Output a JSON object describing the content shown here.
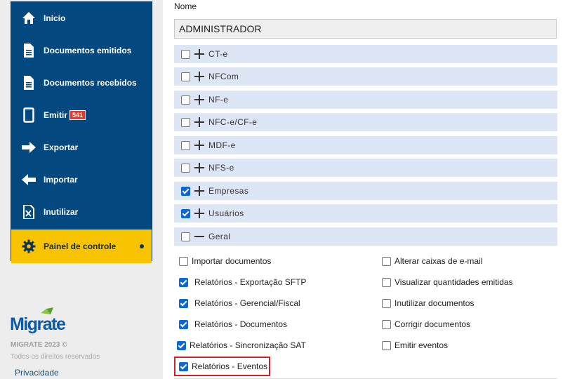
{
  "sidebar": {
    "items": [
      {
        "label": "Início",
        "icon": "home-icon"
      },
      {
        "label": "Documentos emitidos",
        "icon": "document-icon"
      },
      {
        "label": "Documentos recebidos",
        "icon": "document-icon"
      },
      {
        "label": "Emitir",
        "icon": "tablet-icon",
        "badge": "541"
      },
      {
        "label": "Exportar",
        "icon": "arrow-right-icon"
      },
      {
        "label": "Importar",
        "icon": "arrow-left-icon"
      },
      {
        "label": "Inutilizar",
        "icon": "cancel-document-icon"
      },
      {
        "label": "Painel de controle",
        "icon": "gear-icon",
        "active": true
      }
    ]
  },
  "footer": {
    "logo_text": "Migrate",
    "copyright": "MIGRATE 2023 ©",
    "rights": "Todos os direitos reservados",
    "privacy": "Privacidade"
  },
  "form": {
    "name_label": "Nome",
    "name_value": "ADMINISTRADOR"
  },
  "groups": [
    {
      "label": "CT-e",
      "checked": false,
      "expanded": false
    },
    {
      "label": "NFCom",
      "checked": false,
      "expanded": false
    },
    {
      "label": "NF-e",
      "checked": false,
      "expanded": false
    },
    {
      "label": "NFC-e/CF-e",
      "checked": false,
      "expanded": false
    },
    {
      "label": "MDF-e",
      "checked": false,
      "expanded": false
    },
    {
      "label": "NFS-e",
      "checked": false,
      "expanded": false
    },
    {
      "label": "Empresas",
      "checked": true,
      "expanded": false
    },
    {
      "label": "Usuários",
      "checked": true,
      "expanded": false
    },
    {
      "label": "Geral",
      "checked": false,
      "expanded": true
    }
  ],
  "permissions_left": [
    {
      "label": "Importar documentos",
      "checked": false
    },
    {
      "label": "Relatórios - Exportação SFTP",
      "checked": true
    },
    {
      "label": "Relatórios - Gerencial/Fiscal",
      "checked": true
    },
    {
      "label": "Relatórios - Documentos",
      "checked": true
    },
    {
      "label": "Relatórios - Sincronização SAT",
      "checked": true
    },
    {
      "label": "Relatórios - Eventos",
      "checked": true
    }
  ],
  "permissions_right": [
    {
      "label": "Alterar caixas de e-mail",
      "checked": false
    },
    {
      "label": "Visualizar quantidades emitidas",
      "checked": false
    },
    {
      "label": "Inutilizar documentos",
      "checked": false
    },
    {
      "label": "Corrigir documentos",
      "checked": false
    },
    {
      "label": "Emitir eventos",
      "checked": false
    }
  ],
  "colors": {
    "sidebar_bg": "#03497f",
    "active_bg": "#f8c300",
    "badge_bg": "#e23b2b",
    "group_row_bg": "#dce6f4",
    "checkbox_checked": "#0b66d6",
    "highlight_border": "#d0202a"
  }
}
